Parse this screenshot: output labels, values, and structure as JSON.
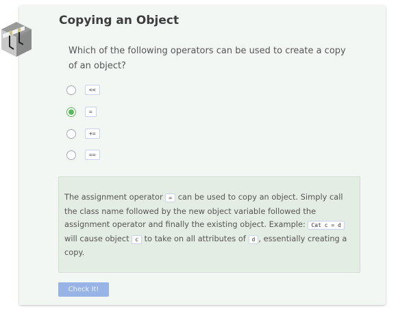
{
  "title": "Copying an Object",
  "question": "Which of the following operators can be used to create a copy of an object?",
  "options": [
    {
      "label": "<<",
      "selected": false
    },
    {
      "label": "=",
      "selected": true
    },
    {
      "label": "+=",
      "selected": false
    },
    {
      "label": "==",
      "selected": false
    }
  ],
  "feedback": {
    "t1": "The assignment operator ",
    "c1": "=",
    "t2": " can be used to copy an object. Simply call the class name followed by the new object variable followed the assignment operator and finally the existing object. Example: ",
    "c2": "Cat c = d",
    "t3": " will cause object ",
    "c3": "c",
    "t4": " to take on all attributes of ",
    "c4": "d",
    "t5": ", essentially creating a copy."
  },
  "check_button": "Check It!",
  "colors": {
    "accent": "#98b4e6",
    "correct": "#5cb85c",
    "feedback_bg": "#e3ede3"
  }
}
